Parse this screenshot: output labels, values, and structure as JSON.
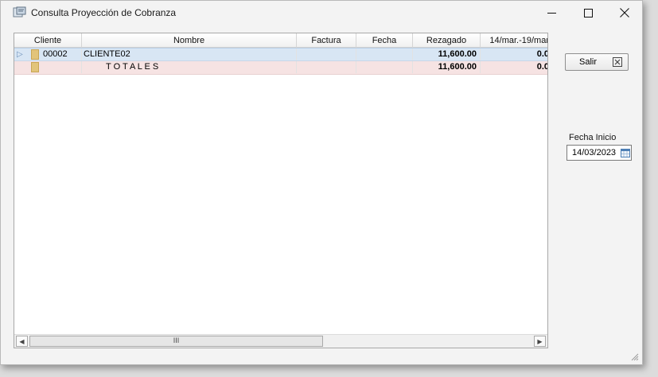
{
  "window": {
    "title": "Consulta Proyección de Cobranza"
  },
  "grid": {
    "columns": [
      "Cliente",
      "Nombre",
      "Factura",
      "Fecha",
      "Rezagado",
      "14/mar.-19/mar"
    ],
    "rows": [
      {
        "cliente": "00002",
        "nombre": "CLIENTE02",
        "factura": "",
        "fecha": "",
        "rezagado": "11,600.00",
        "semana": "0.0"
      },
      {
        "cliente": "",
        "nombre": "T O T A L E S",
        "factura": "",
        "fecha": "",
        "rezagado": "11,600.00",
        "semana": "0.0"
      }
    ],
    "scroll_thumb": "III"
  },
  "buttons": {
    "salir": "Salir"
  },
  "fecha_inicio": {
    "label": "Fecha Inicio",
    "value": "14/03/2023"
  },
  "colors": {
    "selected_row": "#d8e6f4",
    "totals_row": "#f6e3e3"
  }
}
